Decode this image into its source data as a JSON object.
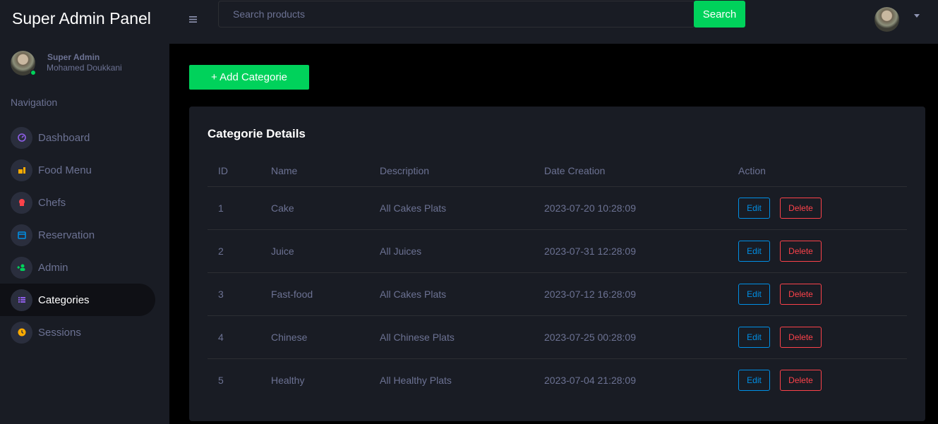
{
  "brand": {
    "title": "Super Admin Panel"
  },
  "profile": {
    "role": "Super Admin",
    "name": "Mohamed Doukkani",
    "status_color": "#00d25b"
  },
  "navigation": {
    "heading": "Navigation",
    "items": [
      {
        "label": "Dashboard",
        "icon": "speedometer-icon",
        "icon_color": "#8f5fe8",
        "active": false
      },
      {
        "label": "Food Menu",
        "icon": "food-icon",
        "icon_color": "#ffab00",
        "active": false
      },
      {
        "label": "Chefs",
        "icon": "chef-hat-icon",
        "icon_color": "#fc424a",
        "active": false
      },
      {
        "label": "Reservation",
        "icon": "calendar-icon",
        "icon_color": "#0090e7",
        "active": false
      },
      {
        "label": "Admin",
        "icon": "users-icon",
        "icon_color": "#00d25b",
        "active": false
      },
      {
        "label": "Categories",
        "icon": "list-icon",
        "icon_color": "#8f5fe8",
        "active": true
      },
      {
        "label": "Sessions",
        "icon": "clock-icon",
        "icon_color": "#ffab00",
        "active": false
      }
    ]
  },
  "topbar": {
    "menu_icon": "hamburger-icon",
    "search_placeholder": "Search products",
    "search_label": "Search"
  },
  "main": {
    "add_label": "+ Add Categorie",
    "card_title": "Categorie Details",
    "table": {
      "headers": [
        "ID",
        "Name",
        "Description",
        "Date Creation",
        "Action"
      ],
      "rows": [
        {
          "id": "1",
          "name": "Cake",
          "description": "All Cakes Plats",
          "date": "2023-07-20 10:28:09",
          "edit": "Edit",
          "delete": "Delete"
        },
        {
          "id": "2",
          "name": "Juice",
          "description": "All Juices",
          "date": "2023-07-31 12:28:09",
          "edit": "Edit",
          "delete": "Delete"
        },
        {
          "id": "3",
          "name": "Fast-food",
          "description": "All Cakes Plats",
          "date": "2023-07-12 16:28:09",
          "edit": "Edit",
          "delete": "Delete"
        },
        {
          "id": "4",
          "name": "Chinese",
          "description": "All Chinese Plats",
          "date": "2023-07-25 00:28:09",
          "edit": "Edit",
          "delete": "Delete"
        },
        {
          "id": "5",
          "name": "Healthy",
          "description": "All Healthy Plats",
          "date": "2023-07-04 21:28:09",
          "edit": "Edit",
          "delete": "Delete"
        }
      ]
    }
  },
  "colors": {
    "accent_green": "#00d25b",
    "edit_blue": "#0090e7",
    "delete_red": "#fc424a",
    "panel": "#191c24",
    "muted_text": "#6c7293"
  }
}
